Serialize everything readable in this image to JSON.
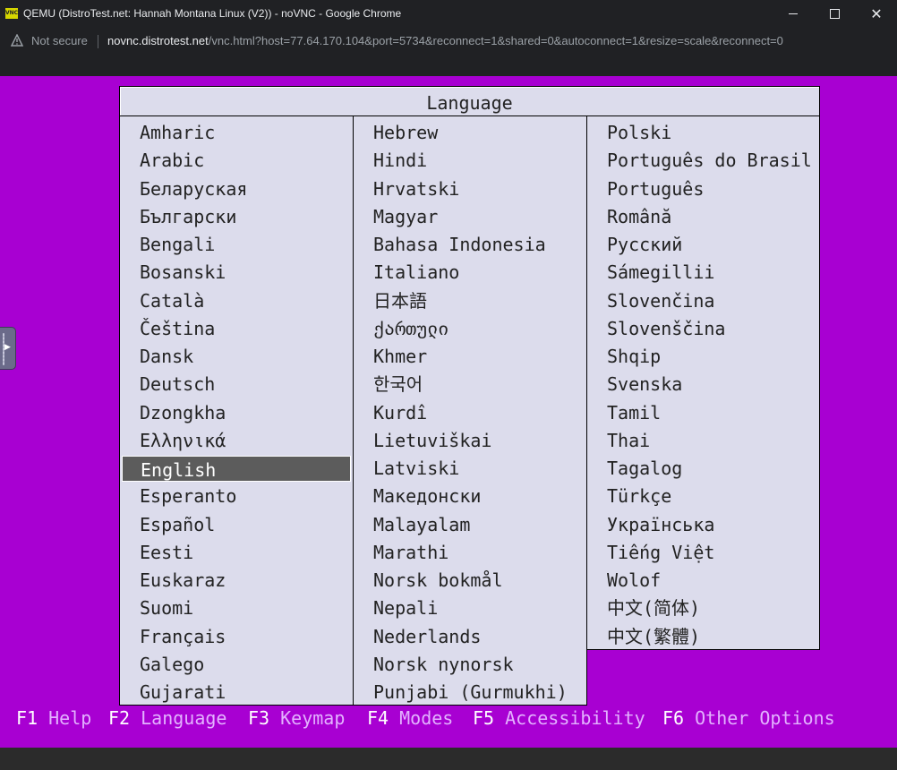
{
  "window": {
    "title": "QEMU (DistroTest.net: Hannah Montana Linux (V2)) - noVNC - Google Chrome",
    "favicon_text": "VNC"
  },
  "address_bar": {
    "security_label": "Not secure",
    "url_host": "novnc.distrotest.net",
    "url_path": "/vnc.html?host=77.64.170.104&port=5734&reconnect=1&shared=0&autoconnect=1&resize=scale&reconnect=0"
  },
  "dialog": {
    "title": "Language",
    "selected": "English",
    "columns": [
      [
        "Amharic",
        "Arabic",
        "Беларуская",
        "Български",
        "Bengali",
        "Bosanski",
        "Català",
        "Čeština",
        "Dansk",
        "Deutsch",
        "Dzongkha",
        "Ελληνικά",
        "English",
        "Esperanto",
        "Español",
        "Eesti",
        "Euskaraz",
        "Suomi",
        "Français",
        "Galego",
        "Gujarati"
      ],
      [
        "Hebrew",
        "Hindi",
        "Hrvatski",
        "Magyar",
        "Bahasa Indonesia",
        "Italiano",
        "日本語",
        "ქართული",
        "Khmer",
        "한국어",
        "Kurdî",
        "Lietuviškai",
        "Latviski",
        "Македонски",
        "Malayalam",
        "Marathi",
        "Norsk bokmål",
        "Nepali",
        "Nederlands",
        "Norsk nynorsk",
        "Punjabi (Gurmukhi)"
      ],
      [
        "Polski",
        "Português do Brasil",
        "Português",
        "Română",
        "Русский",
        "Sámegillii",
        "Slovenčina",
        "Slovenščina",
        "Shqip",
        "Svenska",
        "Tamil",
        "Thai",
        "Tagalog",
        "Türkçe",
        "Українська",
        "Tiếng Việt",
        "Wolof",
        "中文(简体)",
        "中文(繁體)"
      ]
    ]
  },
  "function_keys": [
    {
      "key": "F1",
      "label": "Help"
    },
    {
      "key": "F2",
      "label": "Language"
    },
    {
      "key": "F3",
      "label": "Keymap"
    },
    {
      "key": "F4",
      "label": "Modes"
    },
    {
      "key": "F5",
      "label": "Accessibility"
    },
    {
      "key": "F6",
      "label": "Other Options"
    }
  ],
  "colors": {
    "screen_background": "#a800d2",
    "dialog_background": "#dcdcec",
    "selection": "#5c5c5c",
    "fkey_label": "#e3b2ff"
  }
}
